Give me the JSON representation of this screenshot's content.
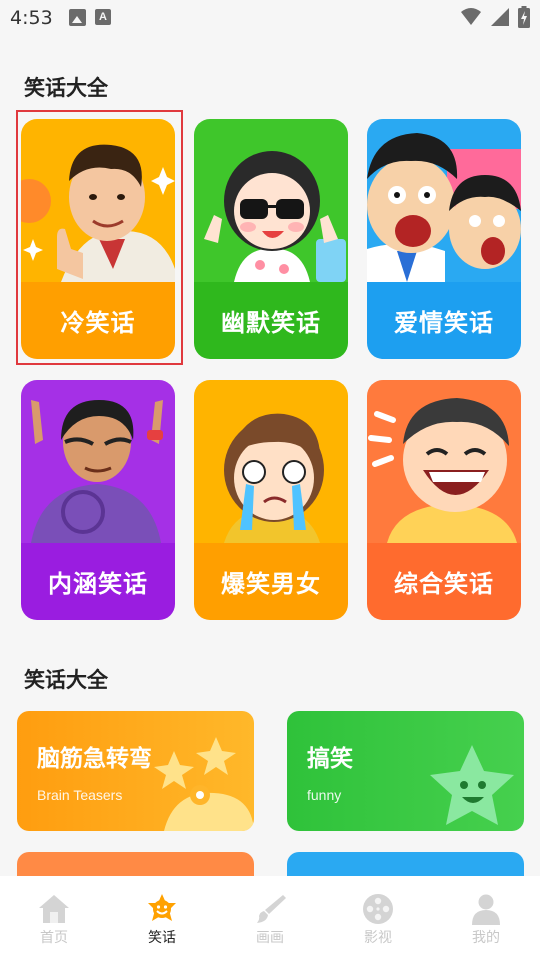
{
  "status_bar": {
    "time": "4:53"
  },
  "section1": {
    "title": "笑话大全"
  },
  "categories": [
    {
      "label": "冷笑话",
      "art_color": "#ffb400",
      "band_color": "#ff9f00"
    },
    {
      "label": "幽默笑话",
      "art_color": "#3fc62b",
      "band_color": "#2fb81d"
    },
    {
      "label": "爱情笑话",
      "art_color": "#2aa9f2",
      "band_color": "#1d9ff0"
    },
    {
      "label": "内涵笑话",
      "art_color": "#a530e6",
      "band_color": "#9a1de0"
    },
    {
      "label": "爆笑男女",
      "art_color": "#ffb400",
      "band_color": "#ff9f00"
    },
    {
      "label": "综合笑话",
      "art_color": "#ff7a3d",
      "band_color": "#ff6b2e"
    }
  ],
  "section2": {
    "title": "笑话大全"
  },
  "features": [
    {
      "title": "脑筋急转弯",
      "subtitle": "Brain Teasers"
    },
    {
      "title": "搞笑",
      "subtitle": "funny"
    }
  ],
  "nav": [
    {
      "label": "首页",
      "icon": "home-icon"
    },
    {
      "label": "笑话",
      "icon": "joke-icon"
    },
    {
      "label": "画画",
      "icon": "brush-icon"
    },
    {
      "label": "影视",
      "icon": "film-reel-icon"
    },
    {
      "label": "我的",
      "icon": "user-icon"
    }
  ],
  "colors": {
    "accent_orange": "#ffa100",
    "selection_border": "#e0393e"
  }
}
